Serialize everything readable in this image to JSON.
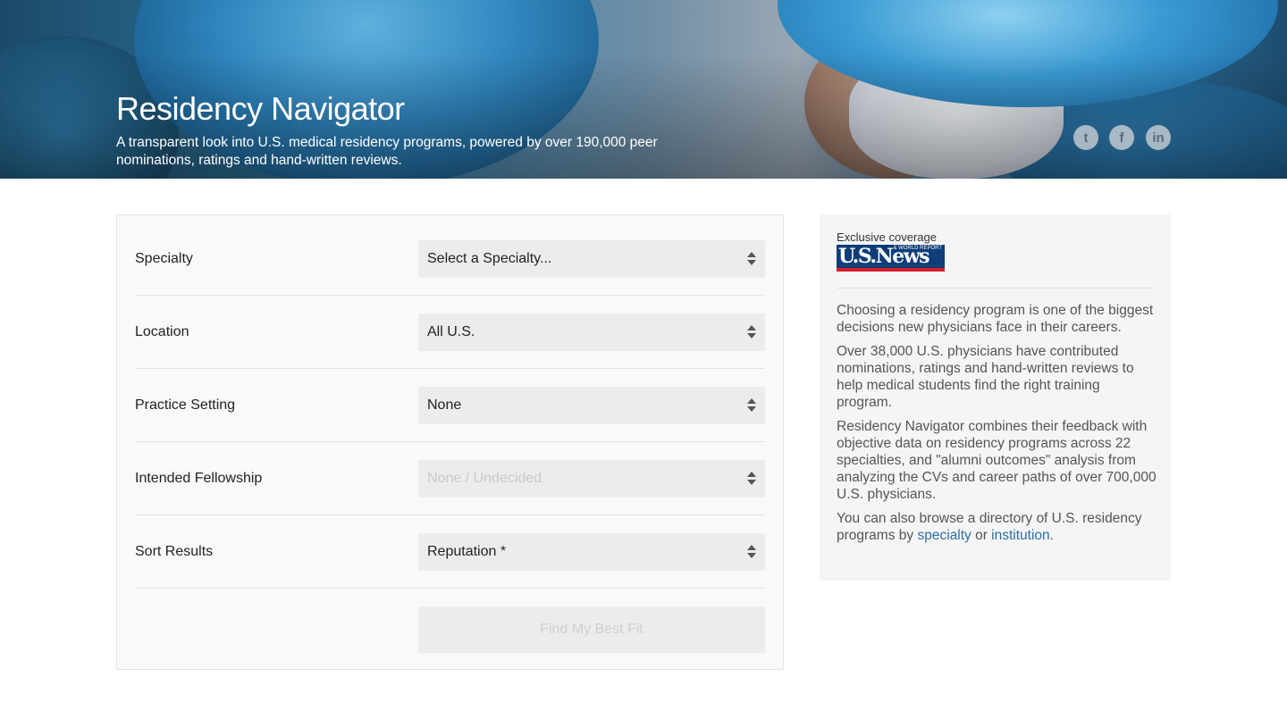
{
  "hero": {
    "title": "Residency Navigator",
    "subtitle": "A transparent look into U.S. medical residency programs, powered by over 190,000 peer nominations, ratings and hand-written reviews.",
    "social": [
      {
        "icon": "twitter-icon",
        "glyph": "t"
      },
      {
        "icon": "facebook-icon",
        "glyph": "f"
      },
      {
        "icon": "linkedin-icon",
        "glyph": "in"
      }
    ]
  },
  "form": {
    "rows": [
      {
        "label": "Specialty",
        "value": "Select a Specialty...",
        "disabled": false
      },
      {
        "label": "Location",
        "value": "All U.S.",
        "disabled": false
      },
      {
        "label": "Practice Setting",
        "value": "None",
        "disabled": false
      },
      {
        "label": "Intended Fellowship",
        "value": "None / Undecided",
        "disabled": true
      },
      {
        "label": "Sort Results",
        "value": "Reputation *",
        "disabled": false
      }
    ],
    "submit_label": "Find My Best Fit"
  },
  "sidebar": {
    "exclusive": "Exclusive coverage",
    "logo_text": "U.S.News",
    "logo_tag": "& WORLD REPORT",
    "para1": "Choosing a residency program is one of the biggest decisions new physicians face in their careers.",
    "para2": "Over 38,000 U.S. physicians have contributed nominations, ratings and hand-written reviews to help medical students find the right training program.",
    "para3": "Residency Navigator combines their feedback with objective data on residency programs across 22 specialties, and \"alumni outcomes\" analysis from analyzing the CVs and career paths of over 700,000 U.S. physicians.",
    "para4_prefix": "You can also browse a directory of U.S. residency programs by ",
    "link_specialty": "specialty",
    "para4_mid": " or ",
    "link_institution": "institution",
    "para4_suffix": "."
  },
  "colors": {
    "link": "#2a6ea8",
    "logo_blue": "#0e3d78",
    "logo_red": "#d41f2c"
  }
}
